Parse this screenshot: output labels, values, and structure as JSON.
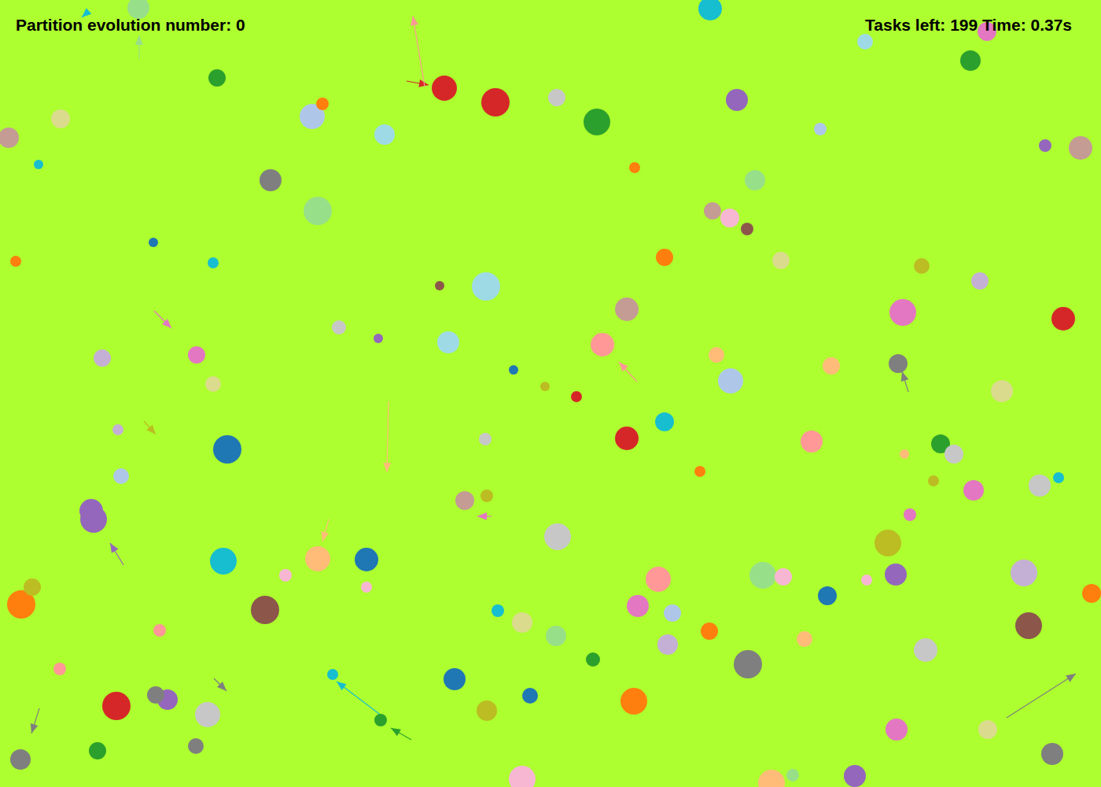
{
  "status": {
    "evolution": "Partition evolution number: 0",
    "tasks": "Tasks left: 199 Time: 0.37s"
  },
  "particles": [
    {
      "color": "#d62728"
    },
    {
      "color": "#d62728"
    },
    {
      "color": "#2ca02c"
    },
    {
      "color": "#c7c7c7"
    },
    {
      "color": "#9467bd"
    },
    {
      "color": "#17becf"
    },
    {
      "color": "#98df8a"
    },
    {
      "color": "#2ca02c"
    },
    {
      "color": "#aec7e8"
    },
    {
      "color": "#ff7f0e"
    },
    {
      "color": "#dbdb8d"
    },
    {
      "color": "#c49c94"
    },
    {
      "color": "#17becf"
    },
    {
      "color": "#7f7f7f"
    },
    {
      "color": "#9edae5"
    },
    {
      "color": "#98df8a"
    },
    {
      "color": "#ff7f0e"
    },
    {
      "color": "#98df8a"
    },
    {
      "color": "#c49c94"
    },
    {
      "color": "#f7b6d2"
    },
    {
      "color": "#8c564b"
    },
    {
      "color": "#ff7f0e"
    },
    {
      "color": "#dbdb8d"
    },
    {
      "color": "#9edae5"
    },
    {
      "color": "#2ca02c"
    },
    {
      "color": "#e377c2"
    },
    {
      "color": "#c49c94"
    },
    {
      "color": "#9467bd"
    },
    {
      "color": "#aec7e8"
    },
    {
      "color": "#bcbd22"
    },
    {
      "color": "#c5b0d5"
    },
    {
      "color": "#e377c2"
    },
    {
      "color": "#d62728"
    },
    {
      "color": "#7f7f7f"
    },
    {
      "color": "#dbdb8d"
    },
    {
      "color": "#2ca02c"
    },
    {
      "color": "#c7c7c7"
    },
    {
      "color": "#e377c2"
    },
    {
      "color": "#c7c7c7"
    },
    {
      "color": "#17becf"
    },
    {
      "color": "#e377c2"
    },
    {
      "color": "#bcbd22"
    },
    {
      "color": "#9467bd"
    },
    {
      "color": "#c5b0d5"
    },
    {
      "color": "#8c564b"
    },
    {
      "color": "#ff7f0e"
    },
    {
      "color": "#c7c7c7"
    },
    {
      "color": "#e377c2"
    },
    {
      "color": "#dbdb8d"
    },
    {
      "color": "#7f7f7f"
    },
    {
      "color": "#9467bd"
    },
    {
      "color": "#ffbb78"
    },
    {
      "color": "#7f7f7f"
    },
    {
      "color": "#ff7f0e"
    },
    {
      "color": "#c5b0d5"
    },
    {
      "color": "#aec7e8"
    },
    {
      "color": "#e377c2"
    },
    {
      "color": "#ff9896"
    },
    {
      "color": "#98df8a"
    },
    {
      "color": "#f7b6d2"
    },
    {
      "color": "#1f77b4"
    },
    {
      "color": "#ffbb78"
    },
    {
      "color": "#ff7f0e"
    },
    {
      "color": "#2ca02c"
    },
    {
      "color": "#98df8a"
    },
    {
      "color": "#dbdb8d"
    },
    {
      "color": "#17becf"
    },
    {
      "color": "#c7c7c7"
    },
    {
      "color": "#1f77b4"
    },
    {
      "color": "#bcbd22"
    },
    {
      "color": "#1f77b4"
    },
    {
      "color": "#f7b6d2"
    },
    {
      "color": "#1f77b4"
    },
    {
      "color": "#ffbb78"
    },
    {
      "color": "#17becf"
    },
    {
      "color": "#8c564b"
    },
    {
      "color": "#f7b6d2"
    },
    {
      "color": "#f7b6d2"
    },
    {
      "color": "#ff9896"
    },
    {
      "color": "#c7c7c7"
    },
    {
      "color": "#9467bd"
    },
    {
      "color": "#7f7f7f"
    },
    {
      "color": "#d62728"
    },
    {
      "color": "#2ca02c"
    },
    {
      "color": "#7f7f7f"
    },
    {
      "color": "#7f7f7f"
    },
    {
      "color": "#ff9896"
    },
    {
      "color": "#ff7f0e"
    },
    {
      "color": "#bcbd22"
    },
    {
      "color": "#9467bd"
    },
    {
      "color": "#9467bd"
    },
    {
      "color": "#aec7e8"
    },
    {
      "color": "#1f77b4"
    },
    {
      "color": "#e377c2"
    },
    {
      "color": "#dbdb8d"
    },
    {
      "color": "#c5b0d5"
    },
    {
      "color": "#c5b0d5"
    },
    {
      "color": "#9edae5"
    },
    {
      "color": "#9edae5"
    },
    {
      "color": "#ff9896"
    },
    {
      "color": "#c49c94"
    },
    {
      "color": "#aec7e8"
    },
    {
      "color": "#ffbb78"
    },
    {
      "color": "#ffbb78"
    },
    {
      "color": "#ff9896"
    },
    {
      "color": "#17becf"
    },
    {
      "color": "#d62728"
    },
    {
      "color": "#d62728"
    },
    {
      "color": "#1f77b4"
    },
    {
      "color": "#bcbd22"
    },
    {
      "color": "#c49c94"
    },
    {
      "color": "#bcbd22"
    },
    {
      "color": "#c7c7c7"
    },
    {
      "color": "#ff7f0e"
    },
    {
      "color": "#c7c7c7"
    },
    {
      "color": "#9467bd"
    },
    {
      "color": "#8c564b"
    },
    {
      "color": "#ff7f0e"
    },
    {
      "color": "#1f77b4"
    },
    {
      "color": "#17becf"
    },
    {
      "color": "#bcbd22"
    },
    {
      "color": "#ffbb78"
    },
    {
      "color": "#f7b6d2"
    },
    {
      "color": "#98df8a"
    },
    {
      "color": "#2ca02c"
    },
    {
      "color": "#17becf"
    }
  ],
  "arrows": [
    {
      "color": "#d62728"
    },
    {
      "color": "#ff9896"
    },
    {
      "color": "#98df8a"
    },
    {
      "color": "#17becf"
    },
    {
      "color": "#e377c2"
    },
    {
      "color": "#ff9896"
    },
    {
      "color": "#7f7f7f"
    },
    {
      "color": "#ffbb78"
    },
    {
      "color": "#bcbd22"
    },
    {
      "color": "#9467bd"
    },
    {
      "color": "#ffbb78"
    },
    {
      "color": "#7f7f7f"
    },
    {
      "color": "#7f7f7f"
    },
    {
      "color": "#2ca02c"
    },
    {
      "color": "#17becf"
    },
    {
      "color": "#7f7f7f"
    },
    {
      "color": "#e377c2"
    }
  ]
}
